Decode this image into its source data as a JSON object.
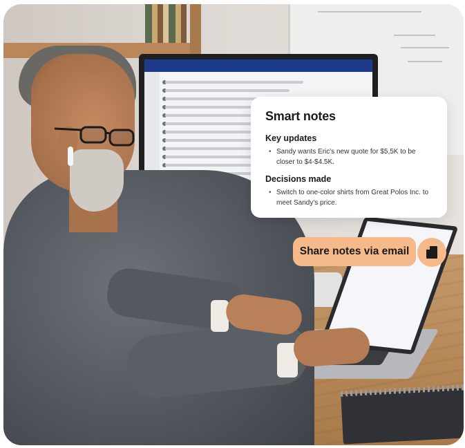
{
  "notes_card": {
    "title": "Smart notes",
    "sections": [
      {
        "heading": "Key updates",
        "items": [
          "Sandy wants Eric's new quote for $5,5K to be closer to $4-$4.5K."
        ]
      },
      {
        "heading": "Decisions made",
        "items": [
          "Switch to one-color shirts from Great Polos Inc. to meet Sandy's price."
        ]
      }
    ],
    "bullet": "•"
  },
  "share": {
    "label": "Share notes via email",
    "icon": "note-icon"
  },
  "colors": {
    "accent": "#f6b98a",
    "card_bg": "#ffffff",
    "text": "#1a1a1a"
  }
}
